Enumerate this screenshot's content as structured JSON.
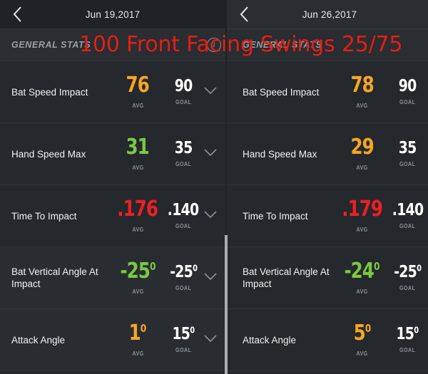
{
  "annotation": {
    "text": "100 Front Facing Swings 25/75",
    "color": "#e31f16"
  },
  "colors": {
    "good": "#7ac943",
    "warn": "#f5a623",
    "bad": "#ed2024",
    "neutral": "#ffffff"
  },
  "panels": [
    {
      "id": "left",
      "topbar": {
        "date": "Jun 19,2017",
        "back_icon": "chevron-left-icon"
      },
      "section": {
        "label": "GENERAL STATS",
        "info_icon": "info-circle-icon",
        "info_glyph": "i"
      },
      "rows": [
        {
          "label": "Bat Speed Impact",
          "avg": "76",
          "avg_deg": "",
          "avg_color": "#f5a623",
          "avg_caption": "AVG",
          "goal": "90",
          "goal_deg": "",
          "goal_caption": "GOAL",
          "chevron": "chevron-down-icon"
        },
        {
          "label": "Hand Speed Max",
          "avg": "31",
          "avg_deg": "",
          "avg_color": "#7ac943",
          "avg_caption": "AVG",
          "goal": "35",
          "goal_deg": "",
          "goal_caption": "GOAL",
          "chevron": "chevron-down-icon"
        },
        {
          "label": "Time To Impact",
          "avg": ".176",
          "avg_deg": "",
          "avg_color": "#ed2024",
          "avg_caption": "AVG",
          "goal": ".140",
          "goal_deg": "",
          "goal_caption": "GOAL",
          "chevron": "chevron-down-icon"
        },
        {
          "label": "Bat Vertical Angle At Impact",
          "avg": "-25",
          "avg_deg": "0",
          "avg_color": "#7ac943",
          "avg_caption": "AVG",
          "goal": "-25",
          "goal_deg": "0",
          "goal_caption": "GOAL",
          "chevron": "chevron-down-icon"
        },
        {
          "label": "Attack Angle",
          "avg": "1",
          "avg_deg": "0",
          "avg_color": "#f5a623",
          "avg_caption": "AVG",
          "goal": "15",
          "goal_deg": "0",
          "goal_caption": "GOAL",
          "chevron": "chevron-down-icon"
        }
      ]
    },
    {
      "id": "right",
      "topbar": {
        "date": "Jun 26,2017",
        "back_icon": "chevron-left-icon"
      },
      "section": {
        "label": "GENERAL STATS",
        "info_icon": "",
        "info_glyph": ""
      },
      "rows": [
        {
          "label": "Bat Speed Impact",
          "avg": "78",
          "avg_deg": "",
          "avg_color": "#f5a623",
          "avg_caption": "AVG",
          "goal": "90",
          "goal_deg": "",
          "goal_caption": "GOAL",
          "chevron": ""
        },
        {
          "label": "Hand Speed Max",
          "avg": "29",
          "avg_deg": "",
          "avg_color": "#f5a623",
          "avg_caption": "AVG",
          "goal": "35",
          "goal_deg": "",
          "goal_caption": "GOAL",
          "chevron": ""
        },
        {
          "label": "Time To Impact",
          "avg": ".179",
          "avg_deg": "",
          "avg_color": "#ed2024",
          "avg_caption": "AVG",
          "goal": ".140",
          "goal_deg": "",
          "goal_caption": "GOAL",
          "chevron": ""
        },
        {
          "label": "Bat Vertical Angle At Impact",
          "avg": "-24",
          "avg_deg": "0",
          "avg_color": "#7ac943",
          "avg_caption": "AVG",
          "goal": "-25",
          "goal_deg": "0",
          "goal_caption": "GOAL",
          "chevron": ""
        },
        {
          "label": "Attack Angle",
          "avg": "5",
          "avg_deg": "0",
          "avg_color": "#f5a623",
          "avg_caption": "AVG",
          "goal": "15",
          "goal_deg": "0",
          "goal_caption": "GOAL",
          "chevron": ""
        }
      ]
    }
  ]
}
